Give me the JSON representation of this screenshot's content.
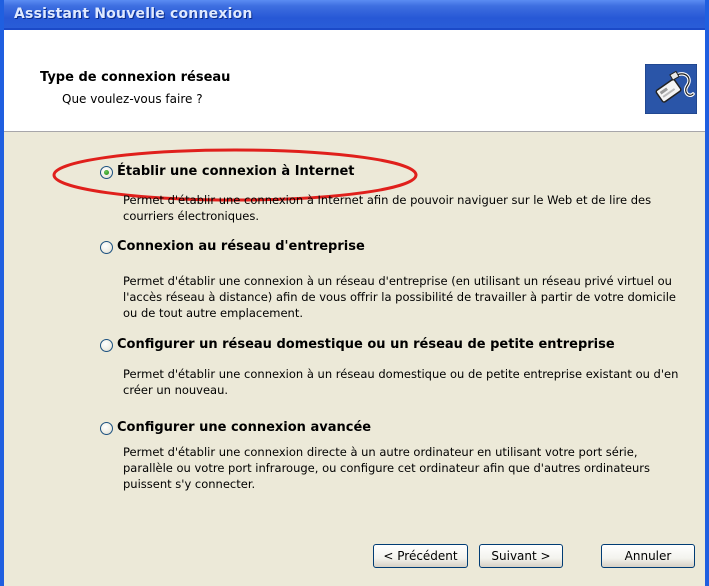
{
  "window": {
    "title": "Assistant Nouvelle connexion"
  },
  "header": {
    "title": "Type de connexion réseau",
    "subtitle": "Que voulez-vous faire ?",
    "icon": "network-connection-icon"
  },
  "options": [
    {
      "label": "Établir une connexion à Internet",
      "description": "Permet d'établir une connexion à Internet afin de pouvoir naviguer sur le Web et de lire des courriers électroniques.",
      "selected": true
    },
    {
      "label": "Connexion au réseau d'entreprise",
      "description": "Permet d'établir une connexion à un réseau d'entreprise (en utilisant un réseau privé virtuel ou l'accès réseau à distance) afin de vous offrir la possibilité de travailler à partir de votre domicile ou de tout autre emplacement.",
      "selected": false
    },
    {
      "label": "Configurer un réseau domestique ou un réseau de petite entreprise",
      "description": "Permet d'établir une connexion à un réseau domestique ou de petite entreprise existant ou d'en créer un nouveau.",
      "selected": false
    },
    {
      "label": "Configurer une connexion avancée",
      "description": "Permet d'établir une connexion directe à un autre ordinateur en utilisant votre port série, parallèle ou votre port infrarouge, ou configure cet ordinateur afin que d'autres ordinateurs puissent s'y connecter.",
      "selected": false
    }
  ],
  "buttons": {
    "previous": "< Précédent",
    "next": "Suivant >",
    "cancel": "Annuler"
  },
  "colors": {
    "titlebar": "#2758d6",
    "dialog_background": "#ece9d8",
    "highlight_ellipse": "#e0201c",
    "radio_selected": "#2f9a22"
  }
}
